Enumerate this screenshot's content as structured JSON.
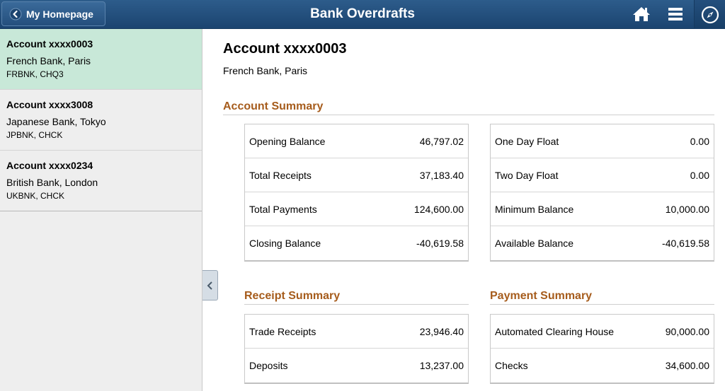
{
  "header": {
    "back_label": "My Homepage",
    "title": "Bank Overdrafts",
    "icons": [
      "chevron-left-icon",
      "home-icon",
      "menu-icon",
      "navbar-compass-icon"
    ]
  },
  "sidebar": {
    "accounts": [
      {
        "title": "Account xxxx0003",
        "bank": "French Bank, Paris",
        "code": "FRBNK, CHQ3",
        "selected": true
      },
      {
        "title": "Account xxxx3008",
        "bank": "Japanese Bank, Tokyo",
        "code": "JPBNK, CHCK",
        "selected": false
      },
      {
        "title": "Account xxxx0234",
        "bank": "British Bank, London",
        "code": "UKBNK, CHCK",
        "selected": false
      }
    ]
  },
  "main": {
    "account_title": "Account xxxx0003",
    "account_bank": "French Bank, Paris",
    "account_summary": {
      "title": "Account Summary",
      "left": [
        {
          "label": "Opening Balance",
          "value": "46,797.02"
        },
        {
          "label": "Total Receipts",
          "value": "37,183.40"
        },
        {
          "label": "Total Payments",
          "value": "124,600.00"
        },
        {
          "label": "Closing Balance",
          "value": "-40,619.58"
        }
      ],
      "right": [
        {
          "label": "One Day Float",
          "value": "0.00"
        },
        {
          "label": "Two Day Float",
          "value": "0.00"
        },
        {
          "label": "Minimum Balance",
          "value": "10,000.00"
        },
        {
          "label": "Available Balance",
          "value": "-40,619.58"
        }
      ]
    },
    "receipt_summary": {
      "title": "Receipt Summary",
      "rows": [
        {
          "label": "Trade Receipts",
          "value": "23,946.40"
        },
        {
          "label": "Deposits",
          "value": "13,237.00"
        }
      ]
    },
    "payment_summary": {
      "title": "Payment Summary",
      "rows": [
        {
          "label": "Automated Clearing House",
          "value": "90,000.00"
        },
        {
          "label": "Checks",
          "value": "34,600.00"
        }
      ]
    }
  },
  "colors": {
    "header": "#1f4a77",
    "selected_row": "#c8e8d8",
    "section_title": "#a65c1c"
  }
}
